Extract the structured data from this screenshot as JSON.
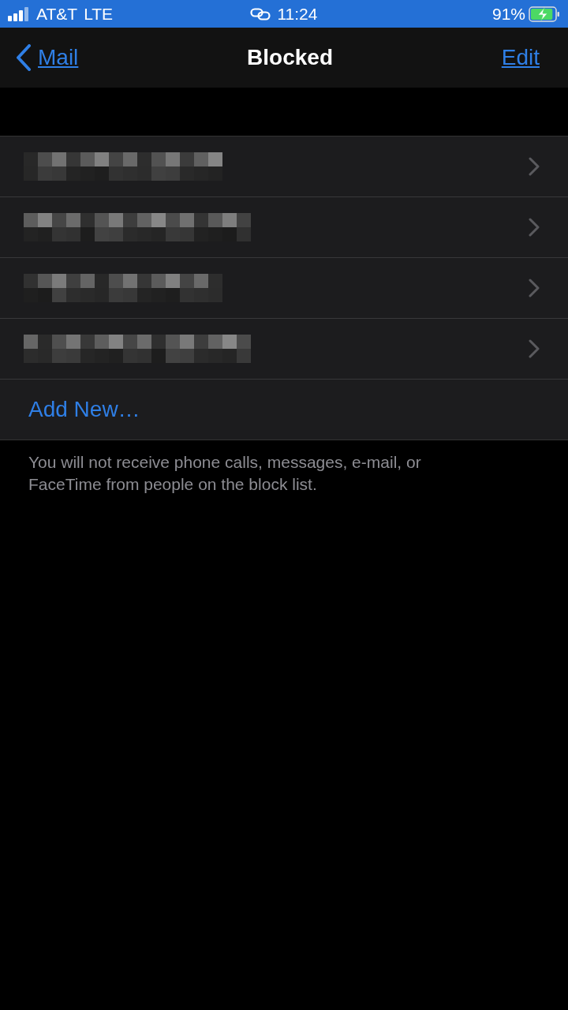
{
  "status_bar": {
    "carrier": "AT&T",
    "network": "LTE",
    "time": "11:24",
    "battery_percent": "91%",
    "battery": {
      "level": 0.91,
      "charging": true
    }
  },
  "nav": {
    "back": "Mail",
    "title": "Blocked",
    "action": "Edit"
  },
  "blocked_contacts": [
    {
      "kind": "redacted"
    },
    {
      "kind": "redacted"
    },
    {
      "kind": "redacted"
    },
    {
      "kind": "redacted"
    }
  ],
  "add_new": "Add New…",
  "footer": "You will not receive phone calls, messages, e-mail, or FaceTime from people on the block list."
}
